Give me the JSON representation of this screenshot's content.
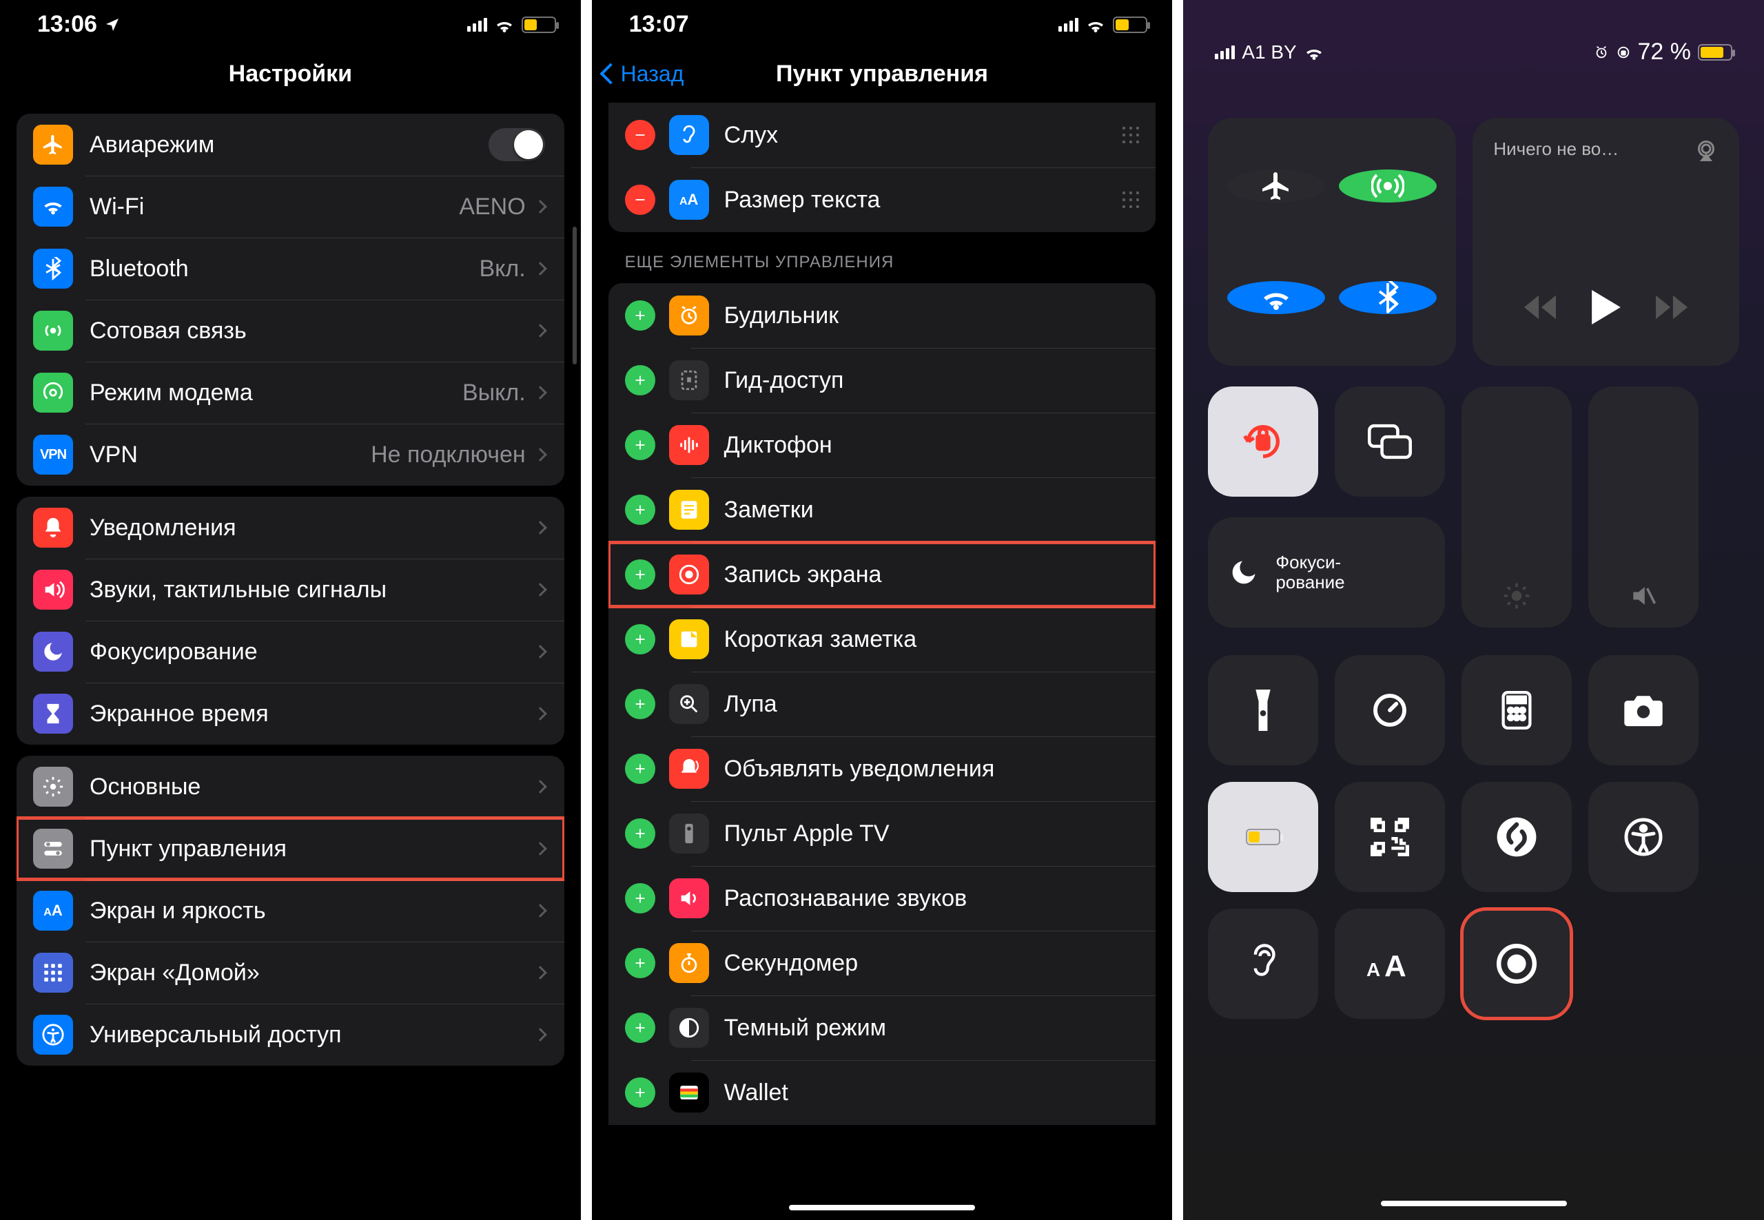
{
  "s1": {
    "time": "13:06",
    "title": "Настройки",
    "battery_pct": 40,
    "g1": [
      {
        "icon": "airplane",
        "bg": "#ff9500",
        "label": "Авиарежим",
        "type": "switch"
      },
      {
        "icon": "wifi",
        "bg": "#007aff",
        "label": "Wi-Fi",
        "value": "AENO",
        "type": "link"
      },
      {
        "icon": "bt",
        "bg": "#007aff",
        "label": "Bluetooth",
        "value": "Вкл.",
        "type": "link"
      },
      {
        "icon": "cell",
        "bg": "#34c759",
        "label": "Сотовая связь",
        "type": "link"
      },
      {
        "icon": "hotspot",
        "bg": "#34c759",
        "label": "Режим модема",
        "value": "Выкл.",
        "type": "link"
      },
      {
        "icon": "vpn",
        "bg": "#007aff",
        "label": "VPN",
        "value": "Не подключен",
        "type": "link"
      }
    ],
    "g2": [
      {
        "icon": "bell",
        "bg": "#ff3b30",
        "label": "Уведомления"
      },
      {
        "icon": "speaker",
        "bg": "#ff2d55",
        "label": "Звуки, тактильные сигналы"
      },
      {
        "icon": "moon",
        "bg": "#5856d6",
        "label": "Фокусирование"
      },
      {
        "icon": "hourglass",
        "bg": "#5856d6",
        "label": "Экранное время"
      }
    ],
    "g3": [
      {
        "icon": "gear",
        "bg": "#8e8e93",
        "label": "Основные"
      },
      {
        "icon": "toggles",
        "bg": "#8e8e93",
        "label": "Пункт управления",
        "hl": true
      },
      {
        "icon": "aa",
        "bg": "#007aff",
        "label": "Экран и яркость"
      },
      {
        "icon": "grid",
        "bg": "#4364d8",
        "label": "Экран «Домой»"
      },
      {
        "icon": "access",
        "bg": "#007aff",
        "label": "Универсальный доступ"
      }
    ]
  },
  "s2": {
    "time": "13:07",
    "back": "Назад",
    "title": "Пункт управления",
    "battery_pct": 40,
    "included_tail": [
      {
        "icon": "ear",
        "bg": "#0a84ff",
        "label": "Слух"
      },
      {
        "icon": "aa",
        "bg": "#0a84ff",
        "label": "Размер текста"
      }
    ],
    "more_h": "ЕЩЕ ЭЛЕМЕНТЫ УПРАВЛЕНИЯ",
    "more": [
      {
        "icon": "alarm",
        "bg": "#ff9500",
        "label": "Будильник"
      },
      {
        "icon": "guided",
        "bg": "#2c2c2e",
        "label": "Гид-доступ"
      },
      {
        "icon": "voice",
        "bg": "#ff3b30",
        "label": "Диктофон"
      },
      {
        "icon": "notes",
        "bg": "#ffcc00",
        "label": "Заметки"
      },
      {
        "icon": "record",
        "bg": "#ff3b30",
        "label": "Запись экрана",
        "hl": true
      },
      {
        "icon": "qnote",
        "bg": "#ffcc00",
        "label": "Короткая заметка"
      },
      {
        "icon": "magnify",
        "bg": "#2c2c2e",
        "label": "Лупа"
      },
      {
        "icon": "announce",
        "bg": "#ff3b30",
        "label": "Объявлять уведомления"
      },
      {
        "icon": "remote",
        "bg": "#2c2c2e",
        "label": "Пульт Apple TV"
      },
      {
        "icon": "sound",
        "bg": "#ff2d55",
        "label": "Распознавание звуков"
      },
      {
        "icon": "stopwatch",
        "bg": "#ff9500",
        "label": "Секундомер"
      },
      {
        "icon": "dark",
        "bg": "#2c2c2e",
        "label": "Темный режим"
      },
      {
        "icon": "wallet",
        "bg": "#000",
        "label": "Wallet"
      }
    ]
  },
  "s3": {
    "carrier": "A1 BY",
    "battery_label": "72 %",
    "battery_pct": 72,
    "media_title": "Ничего не во…",
    "focus_label": "Фокуси-\nрование"
  }
}
